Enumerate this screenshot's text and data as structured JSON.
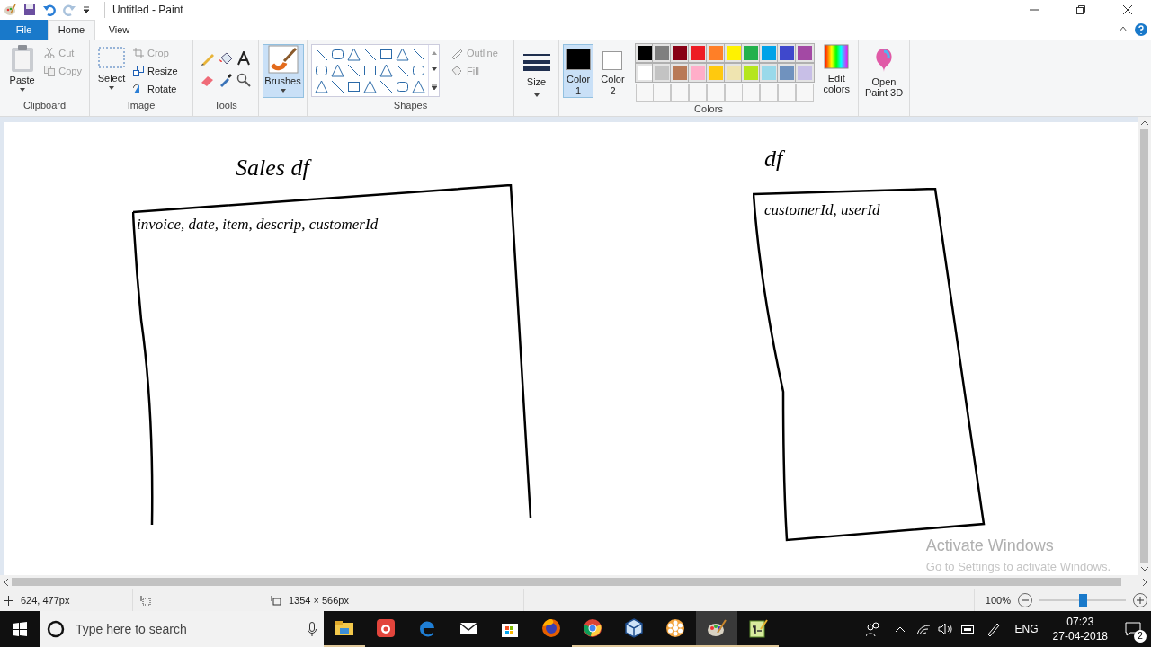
{
  "window": {
    "title": "Untitled - Paint"
  },
  "tabs": [
    {
      "label": "File",
      "kind": "file",
      "selected": false
    },
    {
      "label": "Home",
      "kind": "tab",
      "selected": true
    },
    {
      "label": "View",
      "kind": "tab",
      "selected": false
    }
  ],
  "clipboard": {
    "label": "Clipboard",
    "paste": "Paste",
    "cut": {
      "label": "Cut",
      "disabled": true
    },
    "copy": {
      "label": "Copy",
      "disabled": true
    }
  },
  "image": {
    "label": "Image",
    "select": "Select",
    "crop": {
      "label": "Crop",
      "disabled": true
    },
    "resize": {
      "label": "Resize",
      "disabled": false
    },
    "rotate": {
      "label": "Rotate",
      "disabled": false
    }
  },
  "tools": {
    "label": "Tools"
  },
  "brushes": {
    "label": "Brushes",
    "selected": true
  },
  "shapes": {
    "label": "Shapes",
    "outline": {
      "label": "Outline",
      "disabled": true
    },
    "fill": {
      "label": "Fill",
      "disabled": true
    }
  },
  "size": {
    "label": "Size"
  },
  "colors": {
    "label": "Colors",
    "color1": {
      "label": "Color 1",
      "color": "#000000",
      "selected": true
    },
    "color2": {
      "label": "Color 2",
      "color": "#ffffff",
      "selected": false
    },
    "palette": [
      {
        "color": "#000000"
      },
      {
        "color": "#7f7f7f"
      },
      {
        "color": "#880015"
      },
      {
        "color": "#ed1c24"
      },
      {
        "color": "#ff7f27"
      },
      {
        "color": "#fff200"
      },
      {
        "color": "#22b14c"
      },
      {
        "color": "#00a2e8"
      },
      {
        "color": "#3f48cc"
      },
      {
        "color": "#a349a4"
      },
      {
        "color": "#ffffff"
      },
      {
        "color": "#c3c3c3"
      },
      {
        "color": "#b97a57"
      },
      {
        "color": "#ffaec9"
      },
      {
        "color": "#ffc90e"
      },
      {
        "color": "#efe4b0"
      },
      {
        "color": "#b5e61d"
      },
      {
        "color": "#99d9ea"
      },
      {
        "color": "#7092be"
      },
      {
        "color": "#c8bfe7"
      }
    ],
    "edit": "Edit colors"
  },
  "paint3d": {
    "label": "Open Paint 3D"
  },
  "canvas": {
    "notes": [
      {
        "kind": "title",
        "text": "Sales df"
      },
      {
        "kind": "columns",
        "text": "invoice, date, item, descrip, customerId"
      },
      {
        "kind": "title",
        "text": "df"
      },
      {
        "kind": "columns",
        "text": "customerId, userId"
      }
    ]
  },
  "activation": {
    "title": "Activate Windows",
    "subtitle": "Go to Settings to activate Windows."
  },
  "status_bar": {
    "position": "624, 477px",
    "size": "1354 × 566px",
    "zoom": "100%",
    "level": 0.5
  },
  "taskbar": {
    "search": {
      "placeholder": "Type here to search"
    },
    "apps": [
      {
        "kind": "folder",
        "running": true,
        "selected": false
      },
      {
        "kind": "camera",
        "running": false,
        "selected": false
      },
      {
        "kind": "edge",
        "running": false,
        "selected": false
      },
      {
        "kind": "mail",
        "running": false,
        "selected": false
      },
      {
        "kind": "store",
        "running": false,
        "selected": false
      },
      {
        "kind": "firefox",
        "running": false,
        "selected": false
      },
      {
        "kind": "chrome",
        "running": true,
        "selected": false
      },
      {
        "kind": "cube",
        "running": true,
        "selected": false
      },
      {
        "kind": "flower",
        "running": true,
        "selected": false
      },
      {
        "kind": "paint",
        "running": true,
        "selected": true
      },
      {
        "kind": "editor",
        "running": true,
        "selected": false
      }
    ],
    "language": "ENG",
    "time": "07:23",
    "date": "27-04-2018",
    "notifications": "2"
  }
}
